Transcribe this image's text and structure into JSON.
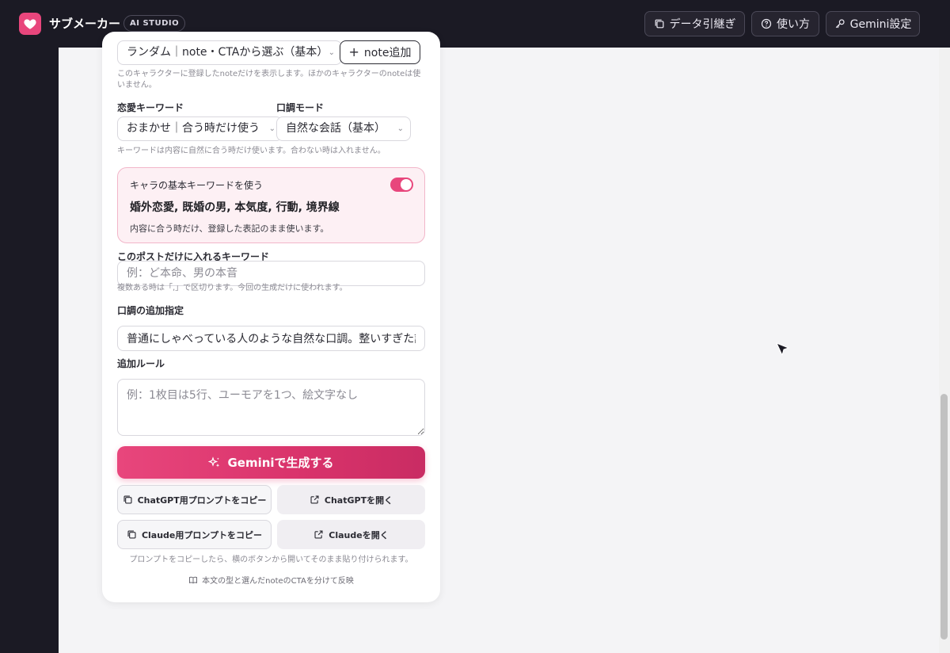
{
  "app": {
    "title": "サブメーカー",
    "badge": "AI STUDIO",
    "brand_color": "#e8467c"
  },
  "topbar": {
    "data_transfer_label": "データ引継ぎ",
    "help_label": "使い方",
    "gemini_settings_label": "Gemini設定"
  },
  "form": {
    "note_select_value": "ランダム｜note・CTAから選ぶ（基本）",
    "note_add_label": "note追加",
    "note_help": "このキャラクターに登録したnoteだけを表示します。ほかのキャラクターのnoteは使いません。",
    "love_keyword_label": "恋愛キーワード",
    "love_keyword_value": "おまかせ｜合う時だけ使う",
    "tone_mode_label": "口調モード",
    "tone_mode_value": "自然な会話（基本）",
    "keyword_help": "キーワードは内容に自然に合う時だけ使います。合わない時は入れません。",
    "base_keyword": {
      "title": "キャラの基本キーワードを使う",
      "toggle_on": true,
      "keywords": "婚外恋愛, 既婚の男, 本気度, 行動, 境界線",
      "help": "内容に合う時だけ、登録した表記のまま使います。"
    },
    "post_keyword_label": "このポストだけに入れるキーワード",
    "post_keyword_placeholder": "例：ど本命、男の本音",
    "post_keyword_help": "複数ある時は「,」で区切ります。今回の生成だけに使われます。",
    "tone_extra_label": "口調の追加指定",
    "tone_extra_value": "普通にしゃべっている人のような自然な口調。整いすぎた説明",
    "extra_rule_label": "追加ルール",
    "extra_rule_placeholder": "例：1枚目は5行、ユーモアを1つ、絵文字なし"
  },
  "actions": {
    "generate_label": "Geminiで生成する",
    "copy_chatgpt_label": "ChatGPT用プロンプトをコピー",
    "open_chatgpt_label": "ChatGPTを開く",
    "copy_claude_label": "Claude用プロンプトをコピー",
    "open_claude_label": "Claudeを開く",
    "copy_help": "プロンプトをコピーしたら、横のボタンから開いてそのまま貼り付けられます。",
    "cta_note": "本文の型と選んだnoteのCTAを分けて反映"
  }
}
